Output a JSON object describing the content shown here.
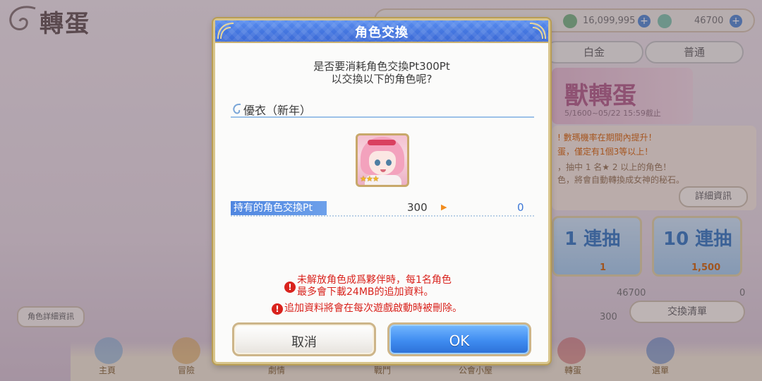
{
  "background": {
    "screen_title": "轉蛋",
    "currency_1": "16,099,995",
    "currency_2": "46700",
    "tab_1": "白金",
    "tab_2": "普通",
    "banner_text": "獸轉蛋",
    "banner_sub": "5/1600~05/22 15:59截止",
    "info_line_1": "!  數瑪機率在期間內提升！",
    "info_line_2": "蛋，僅定有1個3等以上！",
    "info_line_3": "，抽中 1 名★ 2 以上的角色！",
    "info_line_4": "色，將會自動轉換成女神的秘石。",
    "detail_button": "詳細資訊",
    "gacha_1_label": "1 連抽",
    "gacha_1_cost": "1",
    "gacha_10_label": "10 連抽",
    "gacha_10_cost": "1,500",
    "gem_count": "46700",
    "gem_zero": "0",
    "pt_count": "300",
    "exchange_list_button": "交換清單",
    "char_info_button": "角色詳細資訊",
    "nav": [
      "主頁",
      "冒險",
      "劇情",
      "戰鬥",
      "公會小屋",
      "轉蛋",
      "選單"
    ]
  },
  "dialog": {
    "title": "角色交換",
    "confirm_line_1": "是否要消耗角色交換Pt300Pt",
    "confirm_line_2": "以交換以下的角色呢?",
    "character_name": "優衣（新年）",
    "character_stars": "★★★",
    "pt_label": "持有的角色交換Pt",
    "pt_current": "300",
    "pt_arrow": "▶",
    "pt_after": "0",
    "warning_1_line_1": "未解放角色成爲夥伴時，每1名角色",
    "warning_1_line_2": "最多會下載24MB的追加資料。",
    "warning_2": "追加資料將會在每次遊戲啟動時被刪除。",
    "warning_icon": "!",
    "cancel_label": "取消",
    "ok_label": "OK"
  },
  "colors": {
    "header_blue": "#4577e0",
    "gold_border": "#d8c58c",
    "warning_red": "#d9231d",
    "ok_blue": "#3f8cf0"
  }
}
